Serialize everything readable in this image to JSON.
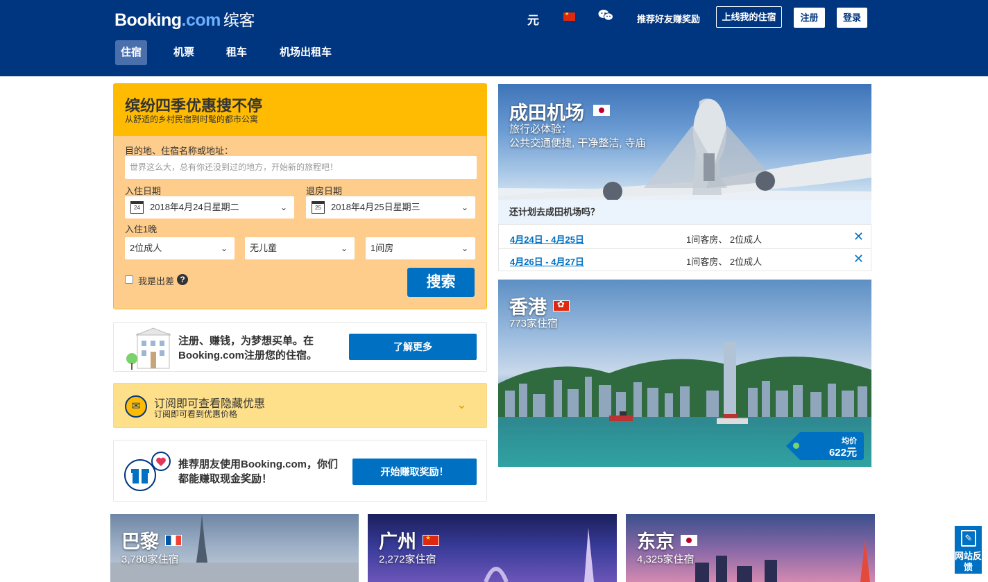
{
  "header": {
    "logo_main": "Booking",
    "logo_dotcom": ".com",
    "logo_cn": "缤客",
    "currency": "元",
    "referral": "推荐好友赚奖励",
    "list_property": "上线我的住宿",
    "register": "注册",
    "login": "登录",
    "nav": [
      {
        "label": "住宿",
        "active": true
      },
      {
        "label": "机票",
        "active": false
      },
      {
        "label": "租车",
        "active": false
      },
      {
        "label": "机场出租车",
        "active": false
      }
    ]
  },
  "search": {
    "promo_title": "缤纷四季优惠搜不停",
    "promo_sub": "从舒适的乡村民宿到时髦的都市公寓",
    "dest_label": "目的地、住宿名称或地址：",
    "dest_placeholder": "世界这么大，总有你还没到过的地方，开始新的旅程吧！",
    "checkin_label": "入住日期",
    "checkin_value": "2018年4月24日星期二",
    "checkin_day": "24",
    "checkout_label": "退房日期",
    "checkout_value": "2018年4月25日星期三",
    "checkout_day": "25",
    "nights": "入住1晚",
    "adults": "2位成人",
    "children": "无儿童",
    "rooms": "1间房",
    "business": "我是出差",
    "help": "?",
    "search_button": "搜索"
  },
  "cards": {
    "register_text": "注册、赚钱，为梦想买单。在Booking.com注册您的住宿。",
    "register_button": "了解更多",
    "subscribe_title": "订阅即可查看隐藏优惠",
    "subscribe_sub": "订阅即可看到优惠价格",
    "refer_text": "推荐朋友使用Booking.com，你们都能赚取现金奖励！",
    "refer_button": "开始赚取奖励！"
  },
  "narita": {
    "title": "成田机场",
    "sub1": "旅行必体验：",
    "sub2": "公共交通便捷, 干净整洁, 寺庙",
    "recent_head": "还计划去成田机场吗？",
    "recent": [
      {
        "dates": "4月24日 - 4月25日",
        "guests": "1间客房、 2位成人"
      },
      {
        "dates": "4月26日 - 4月27日",
        "guests": "1间客房、 2位成人"
      }
    ]
  },
  "hongkong": {
    "title": "香港",
    "count": "773家住宿",
    "price_label": "均价",
    "price": "622元"
  },
  "cities": [
    {
      "name": "巴黎",
      "count": "3,780家住宿"
    },
    {
      "name": "广州",
      "count": "2,272家住宿"
    },
    {
      "name": "东京",
      "count": "4,325家住宿"
    }
  ],
  "feedback": "网站反馈",
  "icons": {
    "wechat": "wechat-icon",
    "calendar": "calendar-icon",
    "close": "close-icon",
    "chevron": "chevron-down-icon"
  },
  "colors": {
    "header_bg": "#003580",
    "accent_blue": "#0071c2",
    "yellow": "#febb02"
  }
}
